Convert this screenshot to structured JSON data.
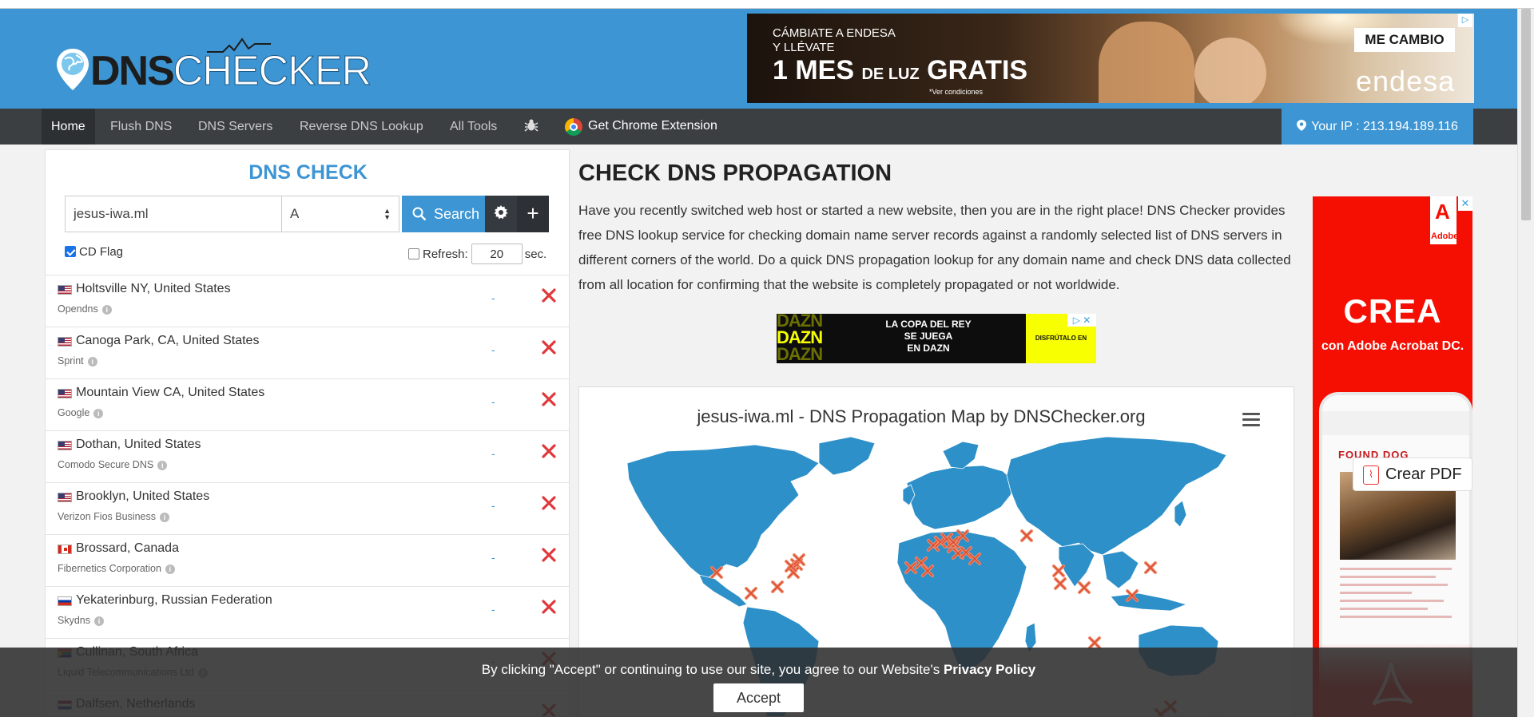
{
  "brand": {
    "dns": "DNS",
    "checker": "CHECKER"
  },
  "ad_top": {
    "line1": "CÁMBIATE A ENDESA",
    "line2": "Y LLÉVATE",
    "headline_a": "1 MES ",
    "headline_small": "DE LUZ",
    "headline_b": " GRATIS",
    "footnote": "*Ver condiciones",
    "cta": "ME CAMBIO",
    "advertiser": "endesa"
  },
  "nav": {
    "home": "Home",
    "flush": "Flush DNS",
    "servers": "DNS Servers",
    "reverse": "Reverse DNS Lookup",
    "tools": "All Tools",
    "extension": "Get Chrome Extension",
    "ip": "Your IP : 213.194.189.116"
  },
  "dns_check": {
    "title": "DNS CHECK",
    "domain": "jesus-iwa.ml",
    "record_type": "A",
    "search_label": "Search",
    "cd_flag_label": "CD Flag",
    "refresh_label": "Refresh:",
    "refresh_value": "20",
    "refresh_unit": "sec."
  },
  "results": [
    {
      "location": "Holtsville NY, United States",
      "provider": "Opendns",
      "flag": "us",
      "status": "-"
    },
    {
      "location": "Canoga Park, CA, United States",
      "provider": "Sprint",
      "flag": "us",
      "status": "-"
    },
    {
      "location": "Mountain View CA, United States",
      "provider": "Google",
      "flag": "us",
      "status": "-"
    },
    {
      "location": "Dothan, United States",
      "provider": "Comodo Secure DNS",
      "flag": "us",
      "status": "-"
    },
    {
      "location": "Brooklyn, United States",
      "provider": "Verizon Fios Business",
      "flag": "us",
      "status": "-"
    },
    {
      "location": "Brossard, Canada",
      "provider": "Fibernetics Corporation",
      "flag": "ca",
      "status": "-"
    },
    {
      "location": "Yekaterinburg, Russian Federation",
      "provider": "Skydns",
      "flag": "ru",
      "status": "-"
    },
    {
      "location": "Cullinan, South Africa",
      "provider": "Liquid Telecommunications Ltd",
      "flag": "za",
      "status": "-"
    },
    {
      "location": "Dalfsen, Netherlands",
      "provider": "",
      "flag": "nl",
      "status": ""
    }
  ],
  "main": {
    "title": "CHECK DNS PROPAGATION",
    "description": "Have you recently switched web host or started a new website, then you are in the right place! DNS Checker provides free DNS lookup service for checking domain name server records against a randomly selected list of DNS servers in different corners of the world. Do a quick DNS propagation lookup for any domain name and check DNS data collected from all location for confirming that the website is completely propagated or not worldwide."
  },
  "ad_dazn": {
    "brand": "DAZN",
    "line1": "LA COPA DEL REY",
    "line2": "SE JUEGA",
    "line3": "EN DAZN",
    "cta": "DISFRÚTALO EN DAZN"
  },
  "map": {
    "title": "jesus-iwa.ml - DNS Propagation Map by DNSChecker.org"
  },
  "ad_right": {
    "brand": "Adobe",
    "headline": "CREA",
    "subline": "con Adobe Acrobat DC.",
    "phone_heading": "FOUND DOG",
    "button": "Crear PDF"
  },
  "cookie": {
    "text": "By clicking \"Accept\" or continuing to use our site, you agree to our Website's ",
    "link": "Privacy Policy",
    "accept": "Accept"
  },
  "colors": {
    "brand_blue": "#3d95d3",
    "nav_dark": "#3c3f42",
    "fail_red": "#e0383b",
    "map_land": "#2e90c8"
  }
}
